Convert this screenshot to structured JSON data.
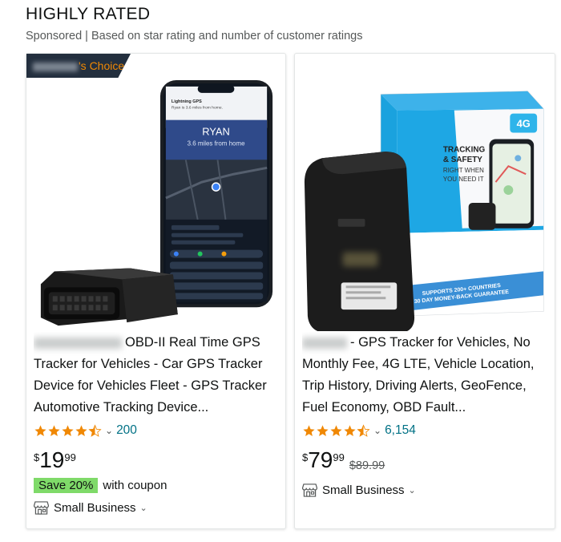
{
  "header": {
    "title": "HIGHLY RATED",
    "subtitle": "Sponsored | Based on star rating and number of customer ratings"
  },
  "products": [
    {
      "badge": "'s Choice",
      "title_text": "OBD-II Real Time GPS Tracker for Vehicles - Car GPS Tracker Device for Vehicles Fleet - GPS Tracker Automotive Tracking Device...",
      "rating_stars": 4.5,
      "rating_count": "200",
      "price_symbol": "$",
      "price_whole": "19",
      "price_fraction": "99",
      "coupon_save": "Save 20%",
      "coupon_text": "with coupon",
      "small_business": "Small Business",
      "phone_screen": {
        "app": "Lightning GPS",
        "notice": "Ryan is 3.6 miles from home.",
        "name": "RYAN",
        "distance": "3.6 miles from home"
      }
    },
    {
      "title_text": "- GPS Tracker for Vehicles, No Monthly Fee, 4G LTE, Vehicle Location, Trip History, Driving Alerts, GeoFence, Fuel Economy, OBD Fault...",
      "rating_stars": 4.5,
      "rating_count": "6,154",
      "price_symbol": "$",
      "price_whole": "79",
      "price_fraction": "99",
      "price_was": "$89.99",
      "small_business": "Small Business",
      "box": {
        "tag": "4G",
        "headline_1": "TRACKING",
        "headline_2": "& SAFETY",
        "sub_1": "RIGHT WHEN",
        "sub_2": "YOU NEED IT",
        "band_1": "30 DAY MONEY-BACK GUARANTEE",
        "band_2": "SUPPORTS 200+ COUNTRIES"
      }
    }
  ],
  "colors": {
    "star": "#f08804",
    "link": "#007185",
    "badge_bg": "#232f3e",
    "coupon_bg": "#7fda69"
  },
  "icons": [
    "star-icon",
    "chevron-down-icon",
    "store-icon"
  ]
}
